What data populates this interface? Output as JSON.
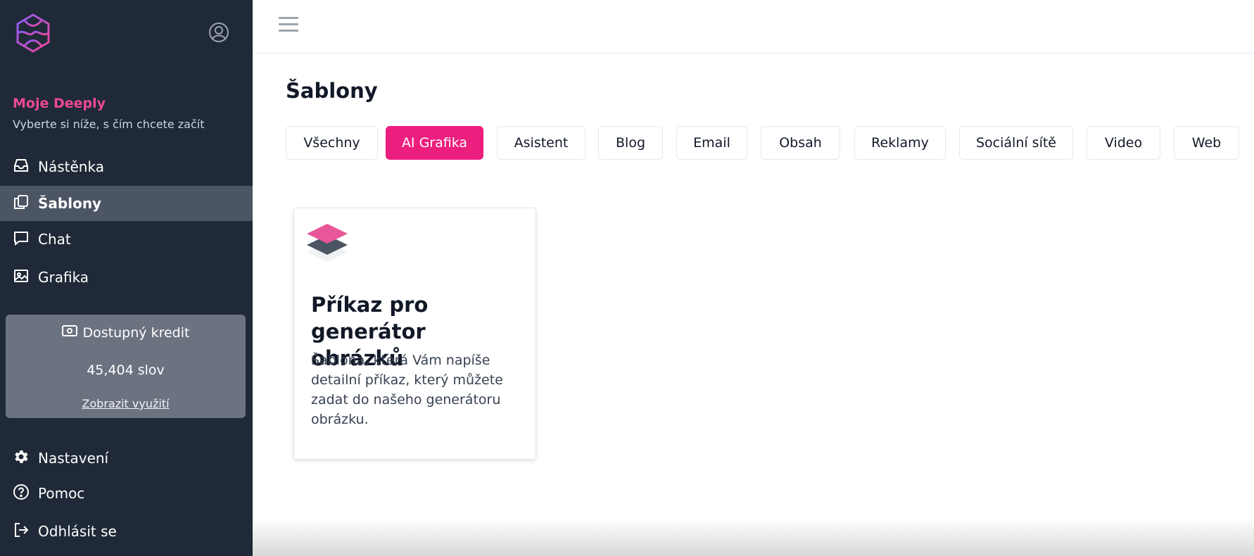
{
  "sidebar": {
    "brand_title": "Moje Deeply",
    "brand_subtitle": "Vyberte si níže, s čím chcete začít",
    "items": [
      {
        "label": "Nástěnka",
        "icon": "inbox-icon"
      },
      {
        "label": "Šablony",
        "icon": "copy-icon",
        "active": true
      },
      {
        "label": "Chat",
        "icon": "chat-icon"
      },
      {
        "label": "Grafika",
        "icon": "image-icon"
      }
    ],
    "credit": {
      "title": "Dostupný kredit",
      "value": "45,404 slov",
      "link": "Zobrazit využití"
    },
    "bottom_items": [
      {
        "label": "Nastavení",
        "icon": "gear-icon"
      },
      {
        "label": "Pomoc",
        "icon": "help-icon"
      },
      {
        "label": "Odhlásit se",
        "icon": "logout-icon"
      }
    ]
  },
  "main": {
    "title": "Šablony",
    "tabs": [
      {
        "label": "Všechny"
      },
      {
        "label": "AI Grafika",
        "active": true
      },
      {
        "label": "Asistent"
      },
      {
        "label": "Blog"
      },
      {
        "label": "Email"
      },
      {
        "label": "Obsah"
      },
      {
        "label": "Reklamy"
      },
      {
        "label": "Sociální sítě"
      },
      {
        "label": "Video"
      },
      {
        "label": "Web"
      }
    ],
    "card": {
      "icon": "layers-icon",
      "title": "Příkaz pro generátor obrázků",
      "description": "Šablona, která Vám napíše detailní příkaz, který můžete zadat do našeho generátoru obrázku."
    }
  },
  "colors": {
    "sidebar_bg": "#1f2937",
    "accent": "#ec1e7e",
    "brand_pink": "#ec4899",
    "active_item_bg": "#4b5563",
    "credit_bg": "#6b7280"
  }
}
